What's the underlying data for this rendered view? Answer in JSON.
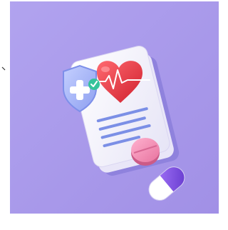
{
  "illustration": {
    "subject": "medical-record",
    "icons": [
      "document-icon",
      "heart-icon",
      "heartbeat-line-icon",
      "shield-cross-icon",
      "checkmark-icon",
      "pill-icon",
      "capsule-icon"
    ],
    "colors": {
      "background": "#a99ae8",
      "paper": "#f3f2fb",
      "paper_shadow": "#8f82dd",
      "heart": "#e5333f",
      "text_lines": "#7b8fe6",
      "shield": "#a3b4ff",
      "check_badge": "#36c39b",
      "pill": "#ee8fb6",
      "capsule": "#7c4fde"
    }
  }
}
